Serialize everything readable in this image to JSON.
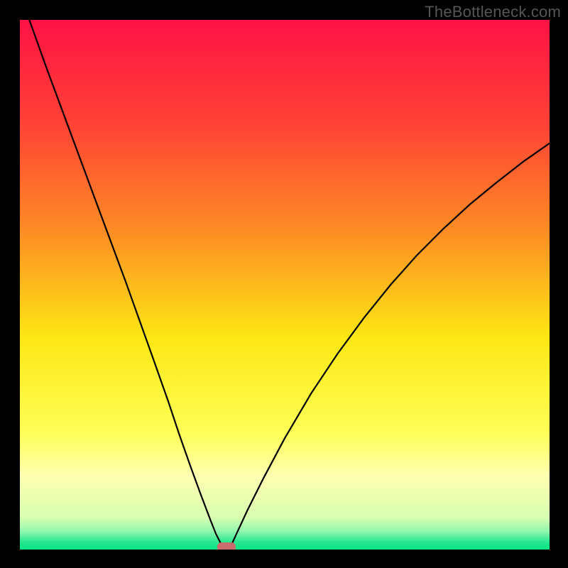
{
  "watermark": "TheBottleneck.com",
  "chart_data": {
    "type": "line",
    "title": "",
    "xlabel": "",
    "ylabel": "",
    "xlim": [
      0,
      100
    ],
    "ylim": [
      0,
      100
    ],
    "grid": false,
    "series": [
      {
        "name": "bottleneck-curve",
        "x": [
          0,
          5,
          10,
          15,
          20,
          25,
          28,
          30,
          32,
          34,
          36,
          37,
          38,
          38.7,
          39.3,
          40,
          41,
          43,
          46,
          50,
          55,
          60,
          65,
          70,
          75,
          80,
          85,
          90,
          95,
          100
        ],
        "y": [
          105,
          91,
          77.5,
          64,
          50.5,
          36.5,
          28,
          22,
          16.3,
          10.8,
          5.5,
          3,
          1,
          0,
          0,
          1,
          3.2,
          7.5,
          13.5,
          21,
          29.5,
          37,
          43.8,
          50,
          55.6,
          60.6,
          65.2,
          69.3,
          73.2,
          76.7
        ]
      }
    ],
    "min_marker": {
      "x": 39,
      "y": 0,
      "color": "#c96c6c"
    },
    "background_gradient": {
      "stops": [
        {
          "offset": 0.0,
          "color": "#ff1245"
        },
        {
          "offset": 0.2,
          "color": "#ff4335"
        },
        {
          "offset": 0.4,
          "color": "#fd8d24"
        },
        {
          "offset": 0.6,
          "color": "#fde714"
        },
        {
          "offset": 0.78,
          "color": "#feff57"
        },
        {
          "offset": 0.86,
          "color": "#ffffb0"
        },
        {
          "offset": 0.94,
          "color": "#d7ffb0"
        },
        {
          "offset": 0.965,
          "color": "#94f7b0"
        },
        {
          "offset": 0.985,
          "color": "#2ae890"
        },
        {
          "offset": 1.0,
          "color": "#09e387"
        }
      ]
    }
  }
}
